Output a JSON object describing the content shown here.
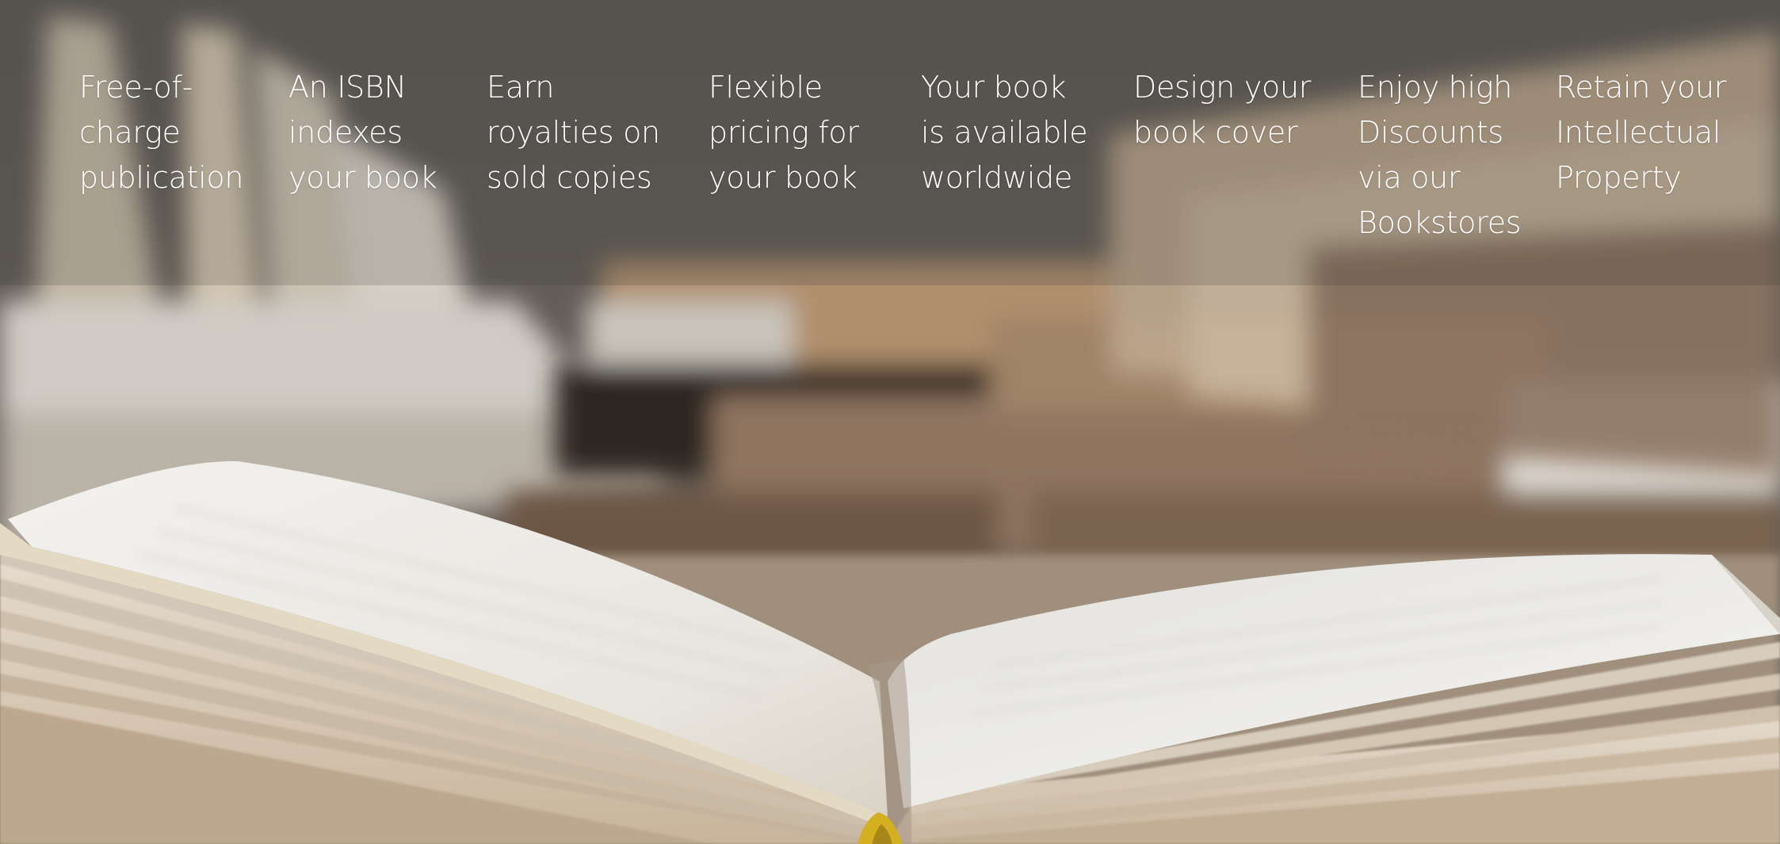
{
  "hero": {
    "background_image": "open-book-on-table-with-blurred-books-background",
    "features": [
      {
        "lines": [
          "Free-of-",
          "charge",
          "publication"
        ]
      },
      {
        "lines": [
          "An ISBN",
          "indexes",
          "your book"
        ]
      },
      {
        "lines": [
          "Earn",
          "royalties on",
          "sold copies"
        ]
      },
      {
        "lines": [
          "Flexible",
          "pricing for",
          "your book"
        ]
      },
      {
        "lines": [
          "Your book",
          "is available",
          "worldwide"
        ]
      },
      {
        "lines": [
          "Design your",
          "book cover"
        ]
      },
      {
        "lines": [
          "Enjoy high",
          "Discounts",
          "via our",
          "Bookstores"
        ]
      },
      {
        "lines": [
          "Retain your",
          "Intellectual",
          "Property"
        ]
      }
    ]
  },
  "colors": {
    "text": "#ffffff",
    "backdrop": "#5a5652",
    "page_paper": "#e8e4dc",
    "bookmark_ribbon": "#d4b020"
  }
}
